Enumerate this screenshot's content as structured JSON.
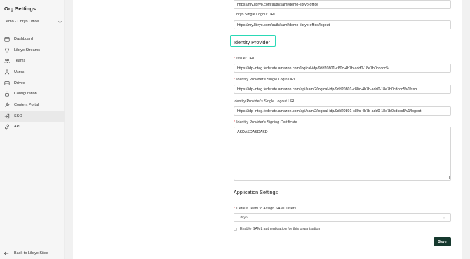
{
  "sidebar": {
    "title": "Org Settings",
    "org_select": {
      "value": "Demo - Libryo Office"
    },
    "items": [
      {
        "label": "Dashboard",
        "icon": "calendar-icon"
      },
      {
        "label": "Libryo Streams",
        "icon": "location-pin-icon"
      },
      {
        "label": "Teams",
        "icon": "users-group-icon"
      },
      {
        "label": "Users",
        "icon": "user-icon"
      },
      {
        "label": "Drives",
        "icon": "drive-icon"
      },
      {
        "label": "Configuration",
        "icon": "lock-icon"
      },
      {
        "label": "Content Portal",
        "icon": "wrench-icon"
      },
      {
        "label": "SSO",
        "icon": "login-icon"
      },
      {
        "label": "API",
        "icon": "link-icon"
      }
    ],
    "active_item": "SSO",
    "back_link": "Back to Libryo Sites"
  },
  "form": {
    "top_input_value": "https://my.libryo.com/auth/saml/demo-libryo-office",
    "single_logout": {
      "label": "Libryo Single Logout URL",
      "value": "https://my.libryo.com/auth/saml/demo-libryo-office/logout"
    },
    "identity_provider_title": "Identity Provider",
    "issuer": {
      "label": "Issuer URL",
      "value": "https://idp-integ.federate.amazon.com/logical-idp/9dd20801-c80c-4b7b-add0-18e7b0cdccc5/"
    },
    "idp_sso": {
      "label": "Identity Provider's Single Login URL",
      "value": "https://idp-integ.federate.amazon.com/api/saml2/logical-idp/9dd20801-c80c-4b7b-add0-18e7b0cdccc5/v1/sso"
    },
    "idp_slo": {
      "label": "Identity Provider's Single Logout URL",
      "value": "https://idp-integ.federate.amazon.com/api/saml2/logical-idp/9dd20801-c80c-4b7b-add0-18e7b0cdccc5/v1/logout"
    },
    "signing_cert": {
      "label": "Identity Provider's Signing Certificate",
      "value": "ASDASDASDASD"
    },
    "application_settings_title": "Application Settings",
    "default_team": {
      "label": "Default Team to Assign SAML Users",
      "value": "Libryo"
    },
    "enable_saml_label": "Enable SAML authentication for this organisation",
    "save_label": "Save"
  },
  "colors": {
    "accent_focus": "#2bd9b6",
    "save_button": "#16392e",
    "required_star": "#e5484d"
  }
}
